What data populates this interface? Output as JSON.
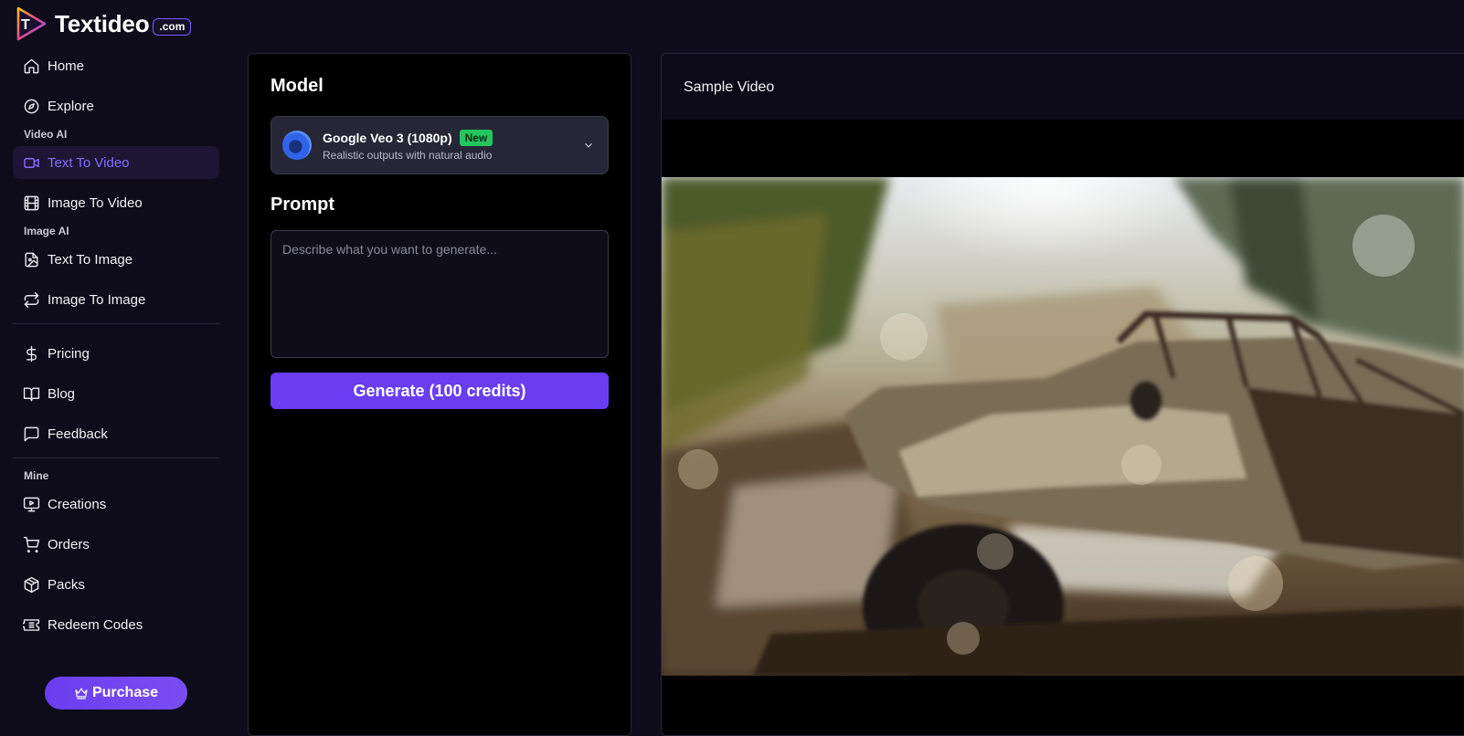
{
  "brand": {
    "name": "Textideo",
    "tld": ".com"
  },
  "sidebar": {
    "items_top": [
      {
        "label": "Home",
        "icon": "home-icon"
      },
      {
        "label": "Explore",
        "icon": "compass-icon"
      }
    ],
    "section_video": "Video AI",
    "items_video": [
      {
        "label": "Text To Video",
        "icon": "video-camera-icon",
        "active": true
      },
      {
        "label": "Image To Video",
        "icon": "film-icon"
      }
    ],
    "section_image": "Image AI",
    "items_image": [
      {
        "label": "Text To Image",
        "icon": "image-file-icon"
      },
      {
        "label": "Image To Image",
        "icon": "repeat-icon"
      }
    ],
    "items_misc": [
      {
        "label": "Pricing",
        "icon": "dollar-icon"
      },
      {
        "label": "Blog",
        "icon": "book-icon"
      },
      {
        "label": "Feedback",
        "icon": "message-square-icon"
      }
    ],
    "section_mine": "Mine",
    "items_mine": [
      {
        "label": "Creations",
        "icon": "monitor-play-icon"
      },
      {
        "label": "Orders",
        "icon": "cart-icon"
      },
      {
        "label": "Packs",
        "icon": "package-icon"
      },
      {
        "label": "Redeem Codes",
        "icon": "ticket-icon"
      }
    ],
    "purchase_label": "Purchase"
  },
  "form": {
    "model_heading": "Model",
    "model": {
      "name": "Google Veo 3 (1080p)",
      "badge": "New",
      "description": "Realistic outputs with natural audio"
    },
    "prompt_heading": "Prompt",
    "prompt_placeholder": "Describe what you want to generate...",
    "prompt_value": "",
    "generate_label": "Generate (100 credits)"
  },
  "preview": {
    "title": "Sample Video"
  },
  "colors": {
    "background": "#0e0b1a",
    "accent": "#6a3df0",
    "active_text": "#8b6cff",
    "badge_green": "#22c55e"
  }
}
